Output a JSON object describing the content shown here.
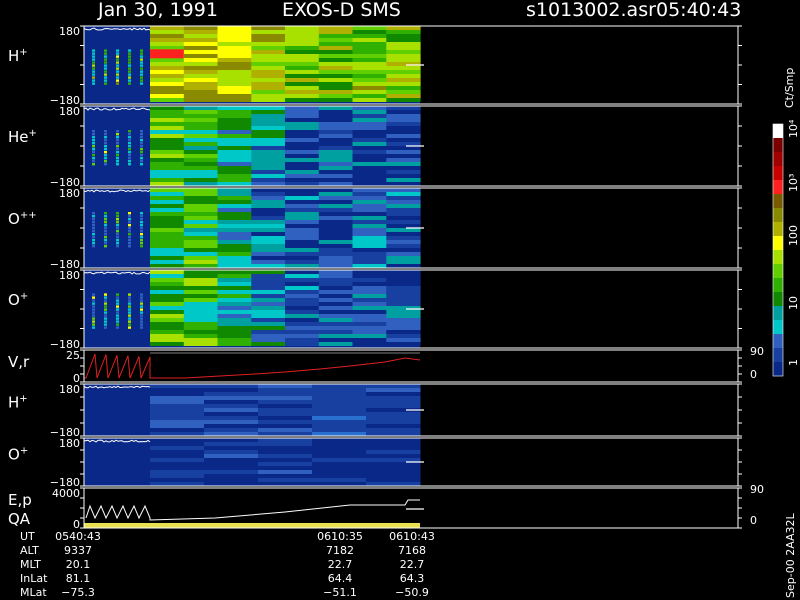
{
  "header": {
    "date": "Jan 30, 1991",
    "instrument": "EXOS-D SMS",
    "file": "s1013002.asr",
    "time": "05:40:43"
  },
  "colorbar": {
    "title": "Ct/Smp",
    "labels": [
      "10⁴",
      "10³",
      "100",
      "10",
      "1"
    ],
    "colors": [
      "#ffffff",
      "#7a0000",
      "#a00000",
      "#c80000",
      "#ff2020",
      "#7a5a00",
      "#8a8a00",
      "#b0b000",
      "#ffff00",
      "#a8e000",
      "#60d000",
      "#30b000",
      "#108800",
      "#00a0a0",
      "#00c8c8",
      "#3060c0",
      "#1840a0",
      "#0a2888"
    ]
  },
  "footer": {
    "side_label": "Sep-00  2AA32L",
    "rows": [
      {
        "label": "UT",
        "values": [
          "0540:43",
          "0610:35",
          "0610:43"
        ]
      },
      {
        "label": "ALT",
        "values": [
          "9337",
          "7182",
          "7168"
        ]
      },
      {
        "label": "MLT",
        "values": [
          "20.1",
          "22.7",
          "22.7"
        ]
      },
      {
        "label": "InLat",
        "values": [
          "81.1",
          "64.4",
          "64.3"
        ]
      },
      {
        "label": "MLat",
        "values": [
          "−75.3",
          "−51.1",
          "−50.9"
        ]
      }
    ]
  },
  "chart_data": {
    "type": "heatmap",
    "title": "Jan 30, 1991   EXOS-D SMS",
    "panels": [
      {
        "id": "h1",
        "label": "H",
        "sup": "+",
        "ymax": "180",
        "ymin": "−180",
        "palette": "bright",
        "seed": 11,
        "streaks": [
          {
            "frac": 0.35,
            "color": "#ff2020"
          }
        ],
        "intensity": [
          0.78,
          0.82,
          0.88,
          0.7,
          0.55,
          0.55,
          0.6,
          0.58
        ]
      },
      {
        "id": "he1",
        "label": "He",
        "sup": "+",
        "ymax": "180",
        "ymin": "−180",
        "palette": "mid",
        "seed": 23,
        "intensity": [
          0.62,
          0.6,
          0.45,
          0.38,
          0.15,
          0.16,
          0.2,
          0.18
        ]
      },
      {
        "id": "opp",
        "label": "O",
        "sup": "++",
        "ymax": "180",
        "ymin": "−180",
        "palette": "mid",
        "seed": 37,
        "intensity": [
          0.6,
          0.58,
          0.44,
          0.3,
          0.18,
          0.15,
          0.22,
          0.2
        ]
      },
      {
        "id": "o1",
        "label": "O",
        "sup": "+",
        "ymax": "180",
        "ymin": "−180",
        "palette": "mid",
        "seed": 41,
        "intensity": [
          0.65,
          0.62,
          0.5,
          0.3,
          0.22,
          0.18,
          0.2,
          0.18
        ]
      },
      {
        "id": "vr",
        "label": "V,r",
        "sup": "",
        "ymax": "25",
        "ymin": "0",
        "rmax": "90",
        "rmin": "0",
        "line": true
      },
      {
        "id": "h2",
        "label": "H",
        "sup": "+",
        "ymax": "180",
        "ymin": "−180",
        "palette": "low",
        "seed": 53,
        "intensity": [
          0.34,
          0.3,
          0.28,
          0.4,
          0.22
        ]
      },
      {
        "id": "o2",
        "label": "O",
        "sup": "+",
        "ymax": "180",
        "ymin": "−180",
        "palette": "low",
        "seed": 67,
        "intensity": [
          0.2,
          0.18,
          0.16,
          0.14,
          0.14
        ]
      },
      {
        "id": "ep",
        "label": "E,p",
        "sup": "",
        "label2": "QA",
        "ymax": "4000",
        "ymin": "0",
        "rmax": "90",
        "rmin": "0",
        "line": true
      }
    ]
  }
}
